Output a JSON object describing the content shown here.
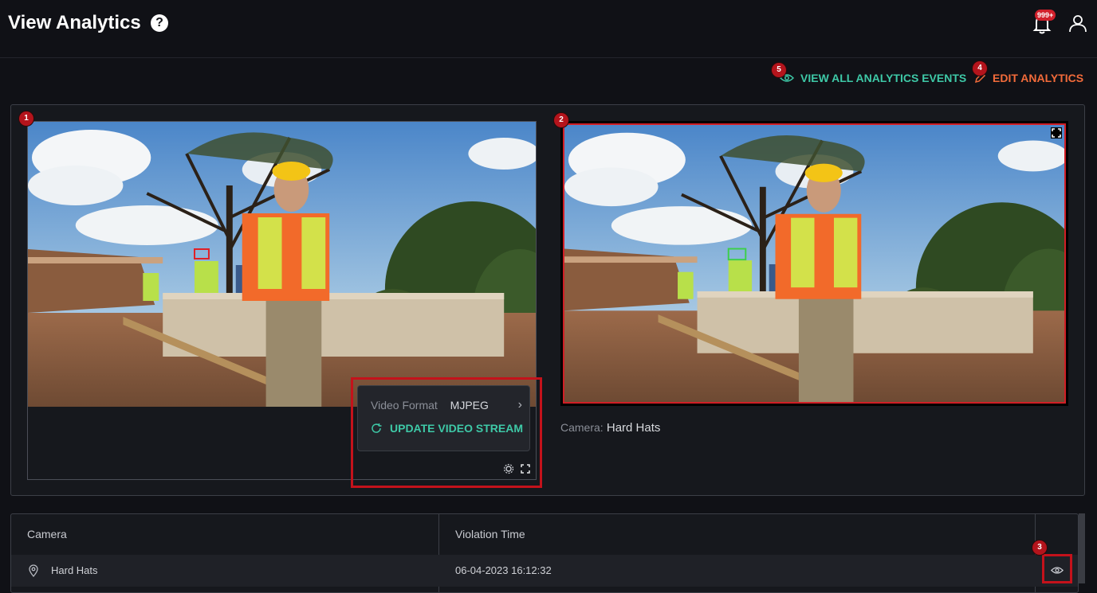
{
  "header": {
    "title": "View Analytics",
    "help_glyph": "?",
    "notification_count": "999+",
    "icons": {
      "help": "help-icon",
      "bell": "bell-icon",
      "user": "user-icon"
    }
  },
  "actions": {
    "view_all_label": "VIEW ALL ANALYTICS EVENTS",
    "edit_label": "EDIT ANALYTICS",
    "view_color": "#3ec9a7",
    "edit_color": "#f26b3a"
  },
  "markers": {
    "m1": "1",
    "m2": "2",
    "m3": "3",
    "m4": "4",
    "m5": "5"
  },
  "video_settings": {
    "format_label": "Video Format",
    "format_value": "MJPEG",
    "update_label": "UPDATE VIDEO STREAM"
  },
  "camera_caption": {
    "label": "Camera:",
    "value": "Hard Hats"
  },
  "table": {
    "columns": [
      "Camera",
      "Violation Time"
    ],
    "rows": [
      {
        "camera": "Hard Hats",
        "violation_time": "06-04-2023 16:12:32"
      }
    ]
  },
  "colors": {
    "accent": "#3ec9a7",
    "alert": "#d1202b",
    "background": "#101116"
  }
}
